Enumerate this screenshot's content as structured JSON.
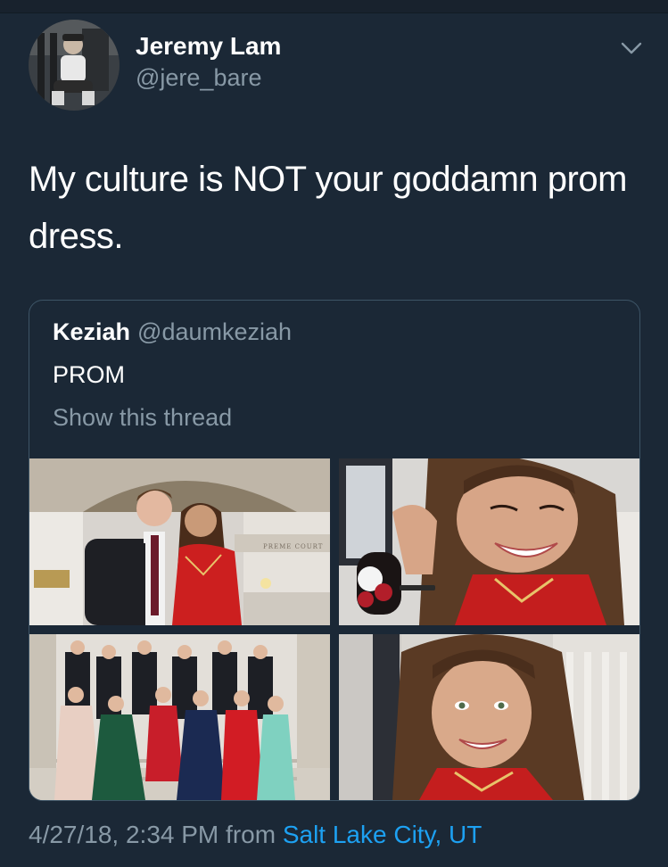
{
  "tweet": {
    "display_name": "Jeremy Lam",
    "handle": "@jere_bare",
    "text": "My culture is NOT your goddamn prom dress.",
    "menu_icon": "chevron-down-icon"
  },
  "quoted_tweet": {
    "display_name": "Keziah",
    "handle": "@daumkeziah",
    "text": "PROM",
    "show_thread_label": "Show this thread",
    "photos": [
      {
        "id": "photo-1",
        "description": "couple at prom in capitol building"
      },
      {
        "id": "photo-2",
        "description": "girl smiling with corsage"
      },
      {
        "id": "photo-3",
        "description": "group photo on staircase"
      },
      {
        "id": "photo-4",
        "description": "girl smiling portrait"
      }
    ],
    "background_text": "PREME COURT"
  },
  "footer": {
    "timestamp": "4/27/18, 2:34 PM",
    "from_word": "from",
    "location": "Salt Lake City, UT"
  },
  "colors": {
    "background": "#1b2836",
    "secondary_text": "#8899a6",
    "link": "#1da1f2",
    "border": "#3d5466"
  }
}
